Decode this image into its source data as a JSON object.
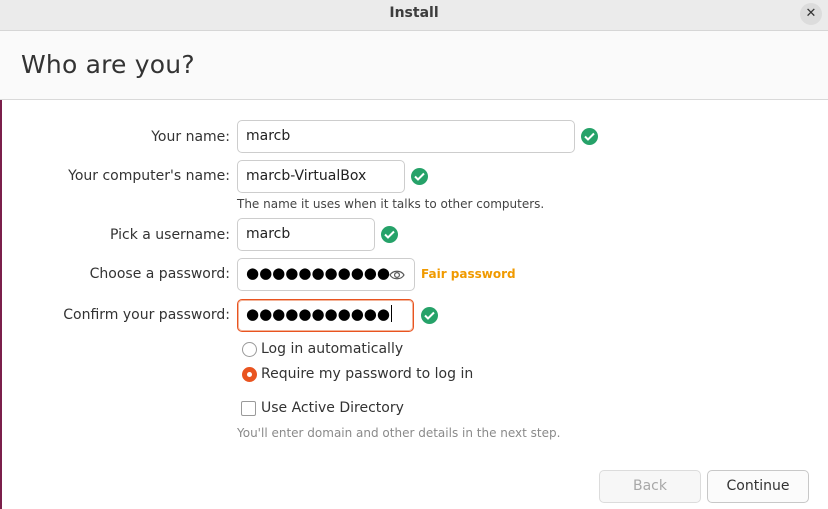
{
  "window": {
    "title": "Install",
    "close_icon": "close-icon"
  },
  "page": {
    "title": "Who are you?"
  },
  "form": {
    "name_label": "Your name:",
    "name_value": "marcb",
    "computer_label": "Your computer's name:",
    "computer_value": "marcb-VirtualBox",
    "computer_hint": "The name it uses when it talks to other computers.",
    "username_label": "Pick a username:",
    "username_value": "marcb",
    "password_label": "Choose a password:",
    "password_value": "●●●●●●●●●●●",
    "password_strength": "Fair password",
    "confirm_label": "Confirm your password:",
    "confirm_value": "●●●●●●●●●●●"
  },
  "login_options": {
    "auto_label": "Log in automatically",
    "require_label": "Require my password to log in",
    "selected": "require"
  },
  "active_directory": {
    "label": "Use Active Directory",
    "checked": false,
    "hint": "You'll enter domain and other details in the next step."
  },
  "buttons": {
    "back": "Back",
    "continue": "Continue"
  },
  "colors": {
    "accent": "#e95420",
    "valid": "#26a269",
    "strength_fair": "#f09a00"
  }
}
